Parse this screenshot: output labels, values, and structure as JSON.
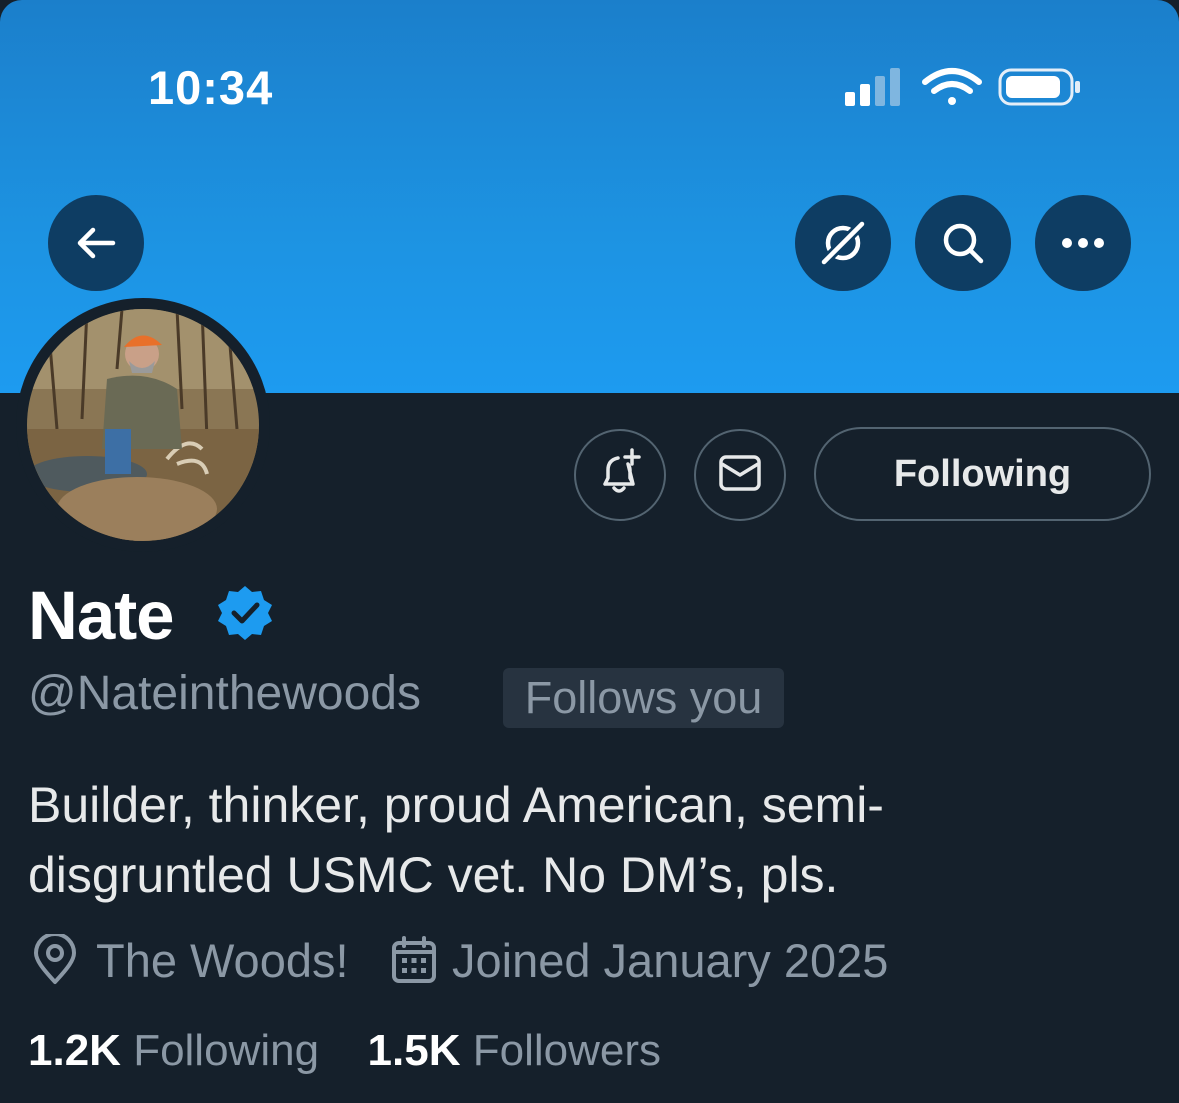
{
  "status_bar": {
    "time": "10:34"
  },
  "header": {
    "back_icon": "arrow-left-icon",
    "grok_icon": "grok-icon",
    "search_icon": "search-icon",
    "more_icon": "more-horizontal-icon"
  },
  "profile": {
    "name": "Nate",
    "handle": "@Nateinthewoods",
    "follows_you": "Follows you",
    "bio": "Builder, thinker, proud American, semi-disgruntled USMC vet. No DM’s, pls.",
    "bio_line1": "Builder, thinker, proud American, semi-",
    "bio_line2": "disgruntled USMC vet. No DM’s, pls.",
    "location": "The Woods!",
    "joined": "Joined January 2025",
    "following_count": "1.2K",
    "following_label": "Following",
    "followers_count": "1.5K",
    "followers_label": "Followers"
  },
  "actions": {
    "notify_icon": "bell-plus-icon",
    "message_icon": "envelope-icon",
    "follow_state_label": "Following"
  },
  "colors": {
    "background": "#15202b",
    "banner": "#1d9bf0",
    "verified": "#1d9bf0",
    "secondary_text": "#8b98a5",
    "border": "#536471"
  }
}
